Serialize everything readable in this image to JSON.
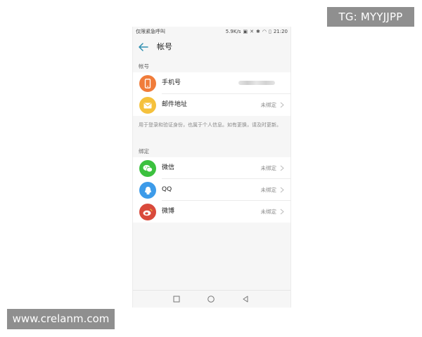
{
  "overlay": {
    "tg_label": "TG: MYYJJPP",
    "site_label": "www.crelanm.com"
  },
  "status_bar": {
    "carrier": "仅限紧急呼叫",
    "speed": "5.9K/s",
    "time": "21:20"
  },
  "app_bar": {
    "title": "帐号",
    "back_icon": "arrow-left-icon"
  },
  "sections": [
    {
      "header": "帐号",
      "items": [
        {
          "label": "手机号",
          "value": "",
          "icon": "phone-icon",
          "color": "#f07c3a",
          "masked": true
        },
        {
          "label": "邮件地址",
          "value": "未绑定",
          "icon": "mail-icon",
          "color": "#f5c13c",
          "masked": false
        }
      ],
      "note": "用于登录和验证身份，也属于个人信息。如有更换，请及时更新。"
    },
    {
      "header": "绑定",
      "items": [
        {
          "label": "微信",
          "value": "未绑定",
          "icon": "wechat-icon",
          "color": "#3cc13f"
        },
        {
          "label": "QQ",
          "value": "未绑定",
          "icon": "qq-icon",
          "color": "#3d9be9"
        },
        {
          "label": "微博",
          "value": "未绑定",
          "icon": "weibo-icon",
          "color": "#d94a3c"
        }
      ]
    }
  ],
  "nav_bar": {
    "buttons": [
      "recents-icon",
      "home-icon",
      "back-triangle-icon"
    ]
  }
}
